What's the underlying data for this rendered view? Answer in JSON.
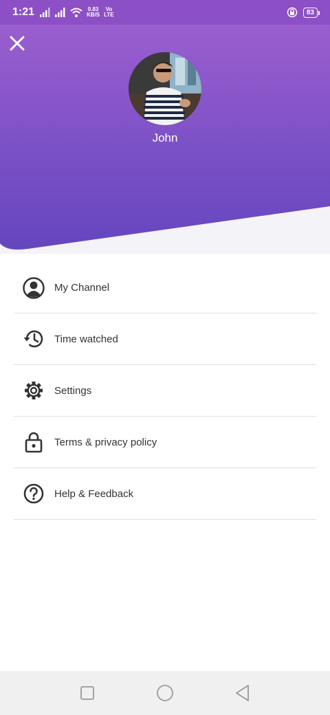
{
  "status_bar": {
    "time": "1:21",
    "net_speed": "0.83",
    "net_unit": "KB/S",
    "volte_top": "Vo",
    "volte_bottom": "LTE",
    "battery": "83"
  },
  "profile": {
    "name": "John",
    "avatar_icon": "user-photo"
  },
  "menu": {
    "items": [
      {
        "label": "My Channel",
        "icon": "account-circle-icon"
      },
      {
        "label": "Time watched",
        "icon": "history-icon"
      },
      {
        "label": "Settings",
        "icon": "gear-icon"
      },
      {
        "label": "Terms & privacy policy",
        "icon": "lock-icon"
      },
      {
        "label": "Help & Feedback",
        "icon": "help-circle-icon"
      }
    ]
  },
  "colors": {
    "header_top": "#9b5fd0",
    "header_bottom": "#6a46c0",
    "text": "#333333"
  }
}
